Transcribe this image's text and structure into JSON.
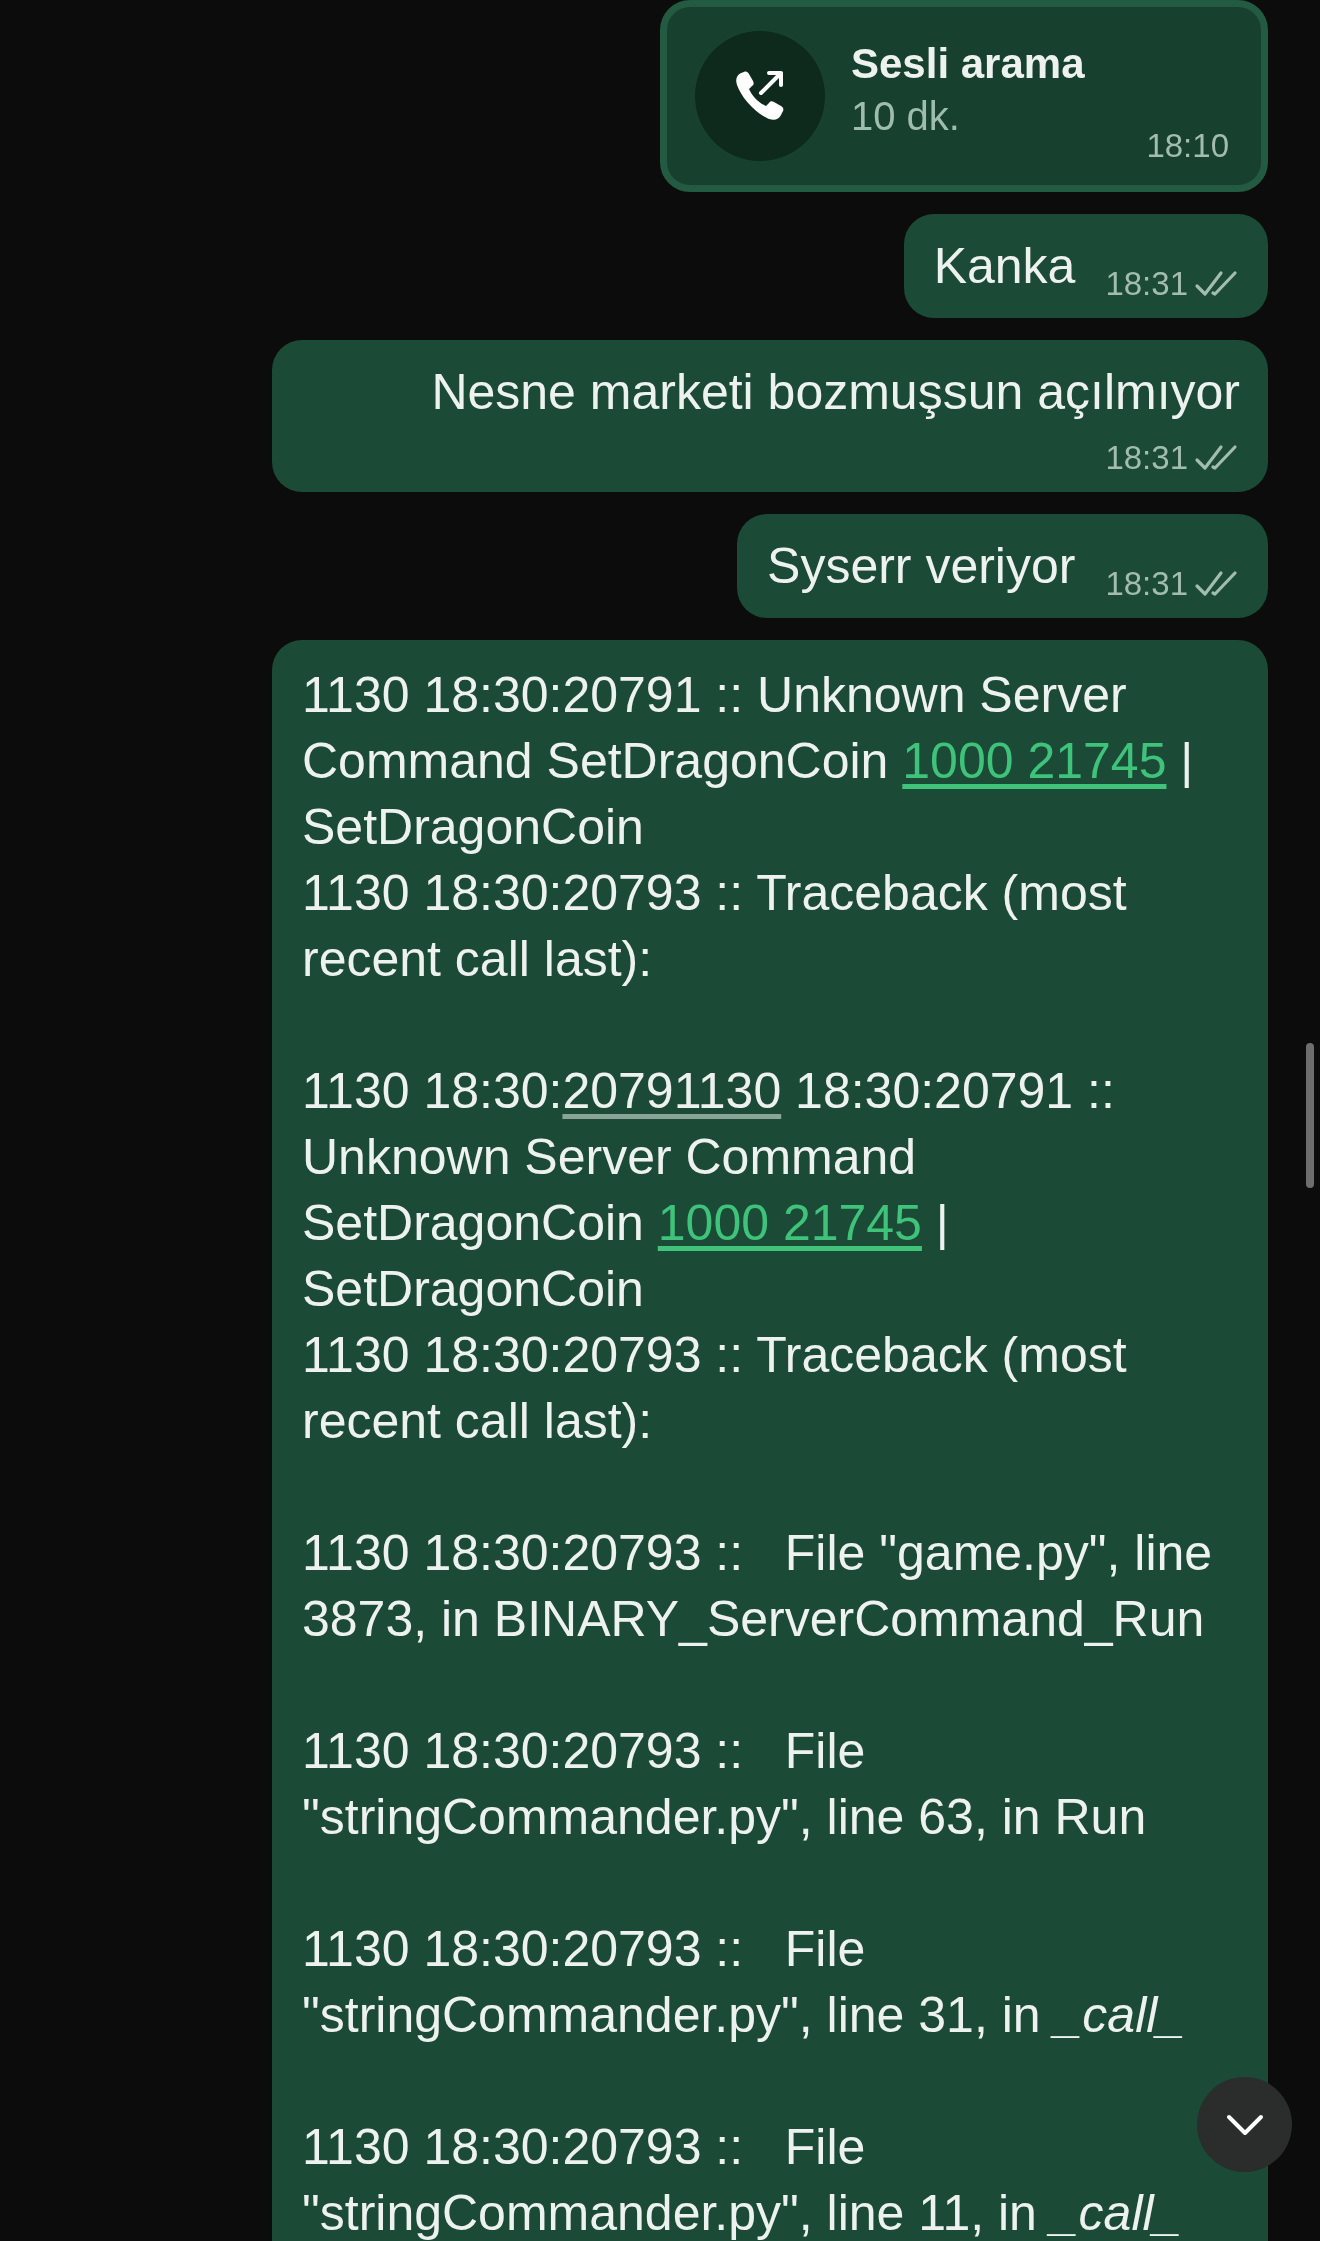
{
  "messages": [
    {
      "kind": "call",
      "title": "Sesli arama",
      "duration": "10 dk.",
      "time": "18:10"
    },
    {
      "kind": "text",
      "text": "Kanka",
      "time": "18:31",
      "read": false
    },
    {
      "kind": "text",
      "text": "Nesne marketi bozmuşsun açılmıyor",
      "time": "18:31",
      "read": false
    },
    {
      "kind": "text",
      "text": "Syserr veriyor",
      "time": "18:31",
      "read": false
    },
    {
      "kind": "log",
      "blocks": [
        [
          [
            {
              "kind": "text",
              "text": "1130 18:30:20791 :: Unknown Server Command SetDragonCoin "
            },
            {
              "kind": "link",
              "text": "1000 21745"
            },
            {
              "kind": "text",
              "text": " | SetDragonCoin"
            }
          ],
          [
            {
              "kind": "text",
              "text": "1130 18:30:20793 :: Traceback (most recent call last):"
            }
          ]
        ],
        [
          [
            {
              "kind": "text",
              "text": "1130 18:30:"
            },
            {
              "kind": "underline",
              "text": "20791130"
            },
            {
              "kind": "text",
              "text": " 18:30:20791 :: Unknown Server Command SetDragonCoin "
            },
            {
              "kind": "link",
              "text": "1000 21745"
            },
            {
              "kind": "text",
              "text": " | SetDragonCoin"
            }
          ],
          [
            {
              "kind": "text",
              "text": "1130 18:30:20793 :: Traceback (most recent call last):"
            }
          ]
        ],
        [
          [
            {
              "kind": "text",
              "text": "1130 18:30:20793 ::   File \"game.py\", line 3873, in BINARY_ServerCommand_Run"
            }
          ]
        ],
        [
          [
            {
              "kind": "text",
              "text": "1130 18:30:20793 ::   File \"stringCommander.py\", line 63, in Run"
            }
          ]
        ],
        [
          [
            {
              "kind": "text",
              "text": "1130 18:30:20793 ::   File \"stringCommander.py\", line 31, in "
            },
            {
              "kind": "italic",
              "text": "_call_"
            }
          ]
        ],
        [
          [
            {
              "kind": "text",
              "text": "1130 18:30:20793 ::   File \"stringCommander.py\", line 11, in "
            },
            {
              "kind": "italic",
              "text": "_call_"
            }
          ]
        ]
      ]
    }
  ]
}
